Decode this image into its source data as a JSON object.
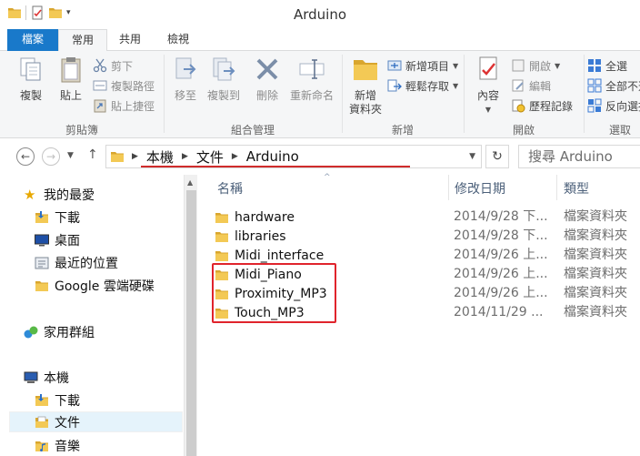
{
  "window": {
    "title": "Arduino"
  },
  "tabs": [
    {
      "label": "檔案"
    },
    {
      "label": "常用"
    },
    {
      "label": "共用"
    },
    {
      "label": "檢視"
    }
  ],
  "ribbon": {
    "clipboard": {
      "label": "剪貼簿",
      "copy": "複製",
      "paste": "貼上",
      "cut": "剪下",
      "copy_path": "複製路徑",
      "paste_shortcut": "貼上捷徑"
    },
    "organize": {
      "label": "組合管理",
      "move_to": "移至",
      "copy_to": "複製到",
      "delete": "刪除",
      "rename": "重新命名"
    },
    "new": {
      "label": "新增",
      "new_folder_line1": "新增",
      "new_folder_line2": "資料夾",
      "new_item": "新增項目",
      "easy_access": "輕鬆存取"
    },
    "open": {
      "label": "開啟",
      "properties": "內容",
      "open": "開啟",
      "edit": "編輯",
      "history": "歷程記錄"
    },
    "select": {
      "label": "選取",
      "select_all": "全選",
      "select_none": "全部不選",
      "invert": "反向選擇"
    }
  },
  "address": {
    "crumbs": [
      "本機",
      "文件",
      "Arduino"
    ],
    "search_placeholder": "搜尋 Arduino"
  },
  "nav": {
    "favorites": "我的最愛",
    "fav_items": [
      "下載",
      "桌面",
      "最近的位置",
      "Google 雲端硬碟"
    ],
    "homegroup": "家用群組",
    "this_pc": "本機",
    "pc_items": [
      "下載",
      "文件",
      "音樂"
    ]
  },
  "columns": {
    "name": "名稱",
    "date": "修改日期",
    "type": "類型"
  },
  "files": [
    {
      "name": "hardware",
      "date": "2014/9/28 下...",
      "type": "檔案資料夾"
    },
    {
      "name": "libraries",
      "date": "2014/9/28 下...",
      "type": "檔案資料夾"
    },
    {
      "name": "Midi_interface",
      "date": "2014/9/26 上...",
      "type": "檔案資料夾"
    },
    {
      "name": "Midi_Piano",
      "date": "2014/9/26 上...",
      "type": "檔案資料夾"
    },
    {
      "name": "Proximity_MP3",
      "date": "2014/9/26 上...",
      "type": "檔案資料夾"
    },
    {
      "name": "Touch_MP3",
      "date": "2014/11/29 ...",
      "type": "檔案資料夾"
    }
  ],
  "colors": {
    "accent": "#1979ca",
    "highlight": "#e0242c",
    "folder": "#e8b83a"
  }
}
